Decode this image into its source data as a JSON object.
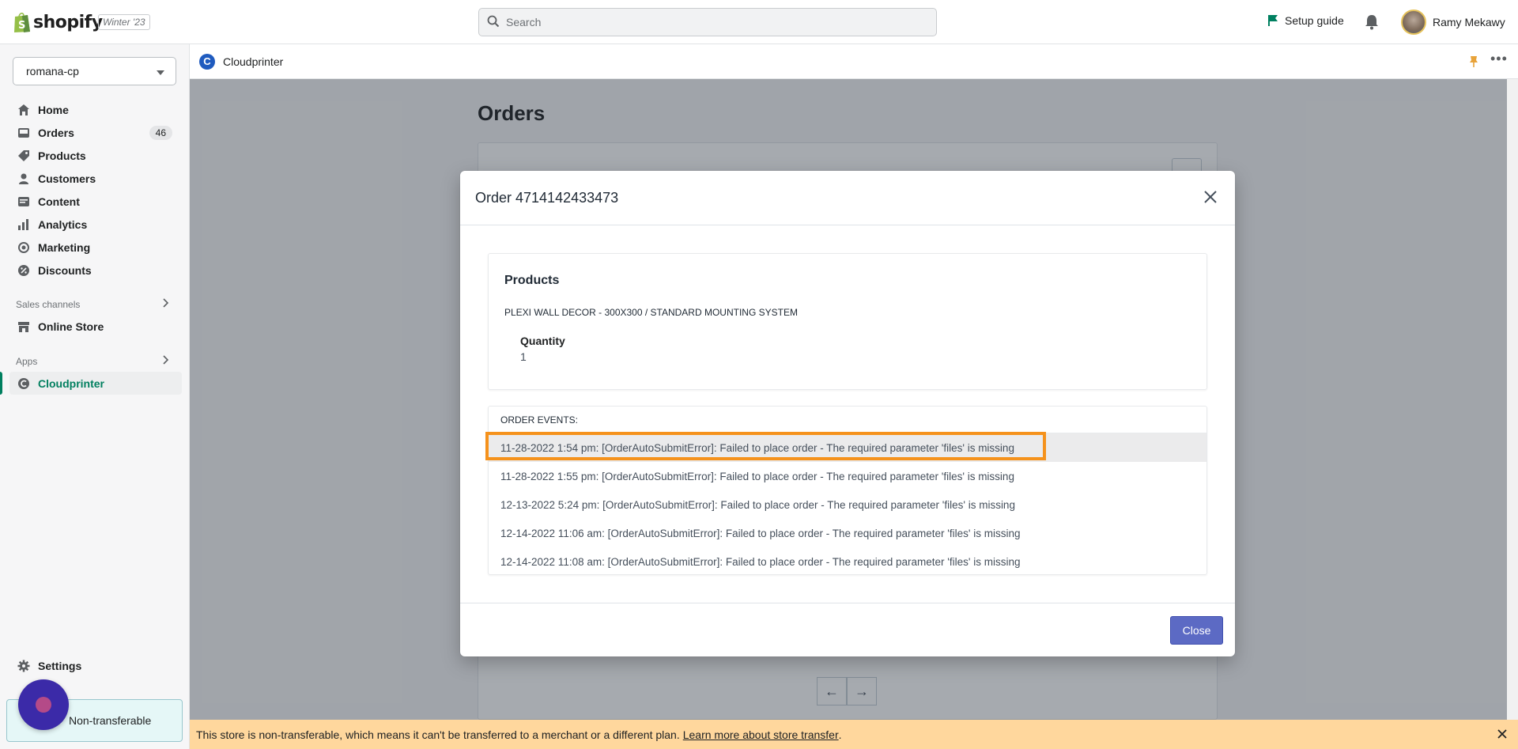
{
  "topbar": {
    "brand": "shopify",
    "version": "Winter '23",
    "search_placeholder": "Search",
    "setup_guide": "Setup guide",
    "user_name": "Ramy Mekawy"
  },
  "sidebar": {
    "store": "romana-cp",
    "items": [
      {
        "label": "Home",
        "icon": "home-icon"
      },
      {
        "label": "Orders",
        "icon": "orders-icon",
        "badge": "46"
      },
      {
        "label": "Products",
        "icon": "tag-icon"
      },
      {
        "label": "Customers",
        "icon": "person-icon"
      },
      {
        "label": "Content",
        "icon": "content-icon"
      },
      {
        "label": "Analytics",
        "icon": "analytics-icon"
      },
      {
        "label": "Marketing",
        "icon": "marketing-icon"
      },
      {
        "label": "Discounts",
        "icon": "discount-icon"
      }
    ],
    "sales_channels_label": "Sales channels",
    "online_store": "Online Store",
    "apps_label": "Apps",
    "cloudprinter": "Cloudprinter",
    "settings": "Settings",
    "non_transferable": "Non-transferable"
  },
  "app_header": {
    "title": "Cloudprinter"
  },
  "page": {
    "title": "Orders"
  },
  "modal": {
    "title": "Order 4714142433473",
    "products_heading": "Products",
    "product_name": "PLEXI WALL DECOR - 300X300 / STANDARD MOUNTING SYSTEM",
    "quantity_label": "Quantity",
    "quantity_value": "1",
    "events_heading": "ORDER EVENTS:",
    "events": [
      "11-28-2022 1:54 pm: [OrderAutoSubmitError]: Failed to place order - The required parameter 'files' is missing",
      "11-28-2022 1:55 pm: [OrderAutoSubmitError]: Failed to place order - The required parameter 'files' is missing",
      "12-13-2022 5:24 pm: [OrderAutoSubmitError]: Failed to place order - The required parameter 'files' is missing",
      "12-14-2022 11:06 am: [OrderAutoSubmitError]: Failed to place order - The required parameter 'files' is missing",
      "12-14-2022 11:08 am: [OrderAutoSubmitError]: Failed to place order - The required parameter 'files' is missing"
    ],
    "close_label": "Close"
  },
  "banner": {
    "text": "This store is non-transferable, which means it can't be transferred to a merchant or a different plan.",
    "link": "Learn more about store transfer",
    "after": "."
  },
  "colors": {
    "highlight": "#f5921c",
    "primary_button": "#5c6ac4",
    "active_nav": "#007f5f",
    "banner": "#ffd79d"
  }
}
